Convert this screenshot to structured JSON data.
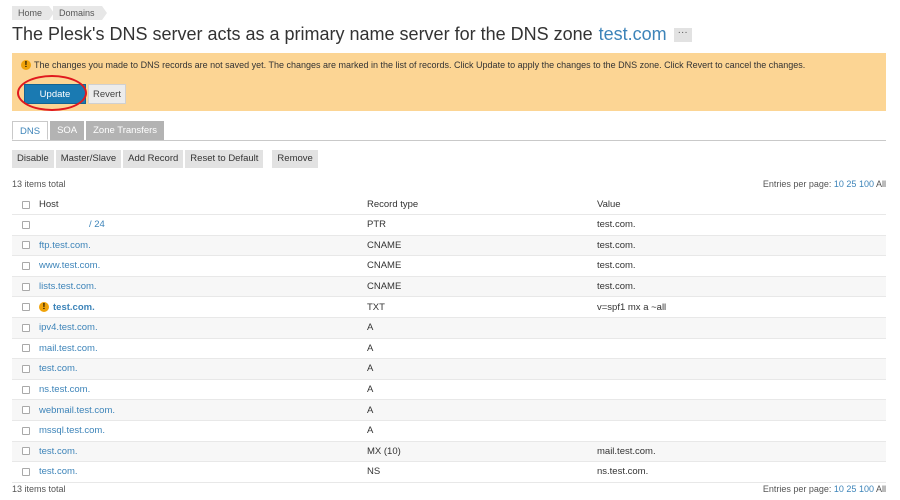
{
  "breadcrumbs": [
    "Home",
    "Domains"
  ],
  "title": {
    "prefix": "The Plesk's DNS server acts as a primary name server for the DNS zone",
    "zone": "test.com",
    "more": "···"
  },
  "warning": {
    "text": "The changes you made to DNS records are not saved yet. The changes are marked in the list of records. Click Update to apply the changes to the DNS zone. Click Revert to cancel the changes.",
    "update_label": "Update",
    "revert_label": "Revert"
  },
  "tabs": [
    "DNS",
    "SOA",
    "Zone Transfers"
  ],
  "toolbar": [
    "Disable",
    "Master/Slave",
    "Add Record",
    "Reset to Default",
    "Remove"
  ],
  "summary": {
    "total": "13 items total",
    "per_page_label": "Entries per page:",
    "per_page_options": [
      "10",
      "25",
      "100"
    ],
    "per_page_all": "All"
  },
  "columns": [
    "Host",
    "Record type",
    "Value"
  ],
  "records": [
    {
      "host": "/ 24",
      "type": "PTR",
      "value": "test.com."
    },
    {
      "host": "ftp.test.com.",
      "type": "CNAME",
      "value": "test.com."
    },
    {
      "host": "www.test.com.",
      "type": "CNAME",
      "value": "test.com."
    },
    {
      "host": "lists.test.com.",
      "type": "CNAME",
      "value": "test.com."
    },
    {
      "host": "test.com.",
      "type": "TXT",
      "value": "v=spf1 mx a ~all"
    },
    {
      "host": "ipv4.test.com.",
      "type": "A",
      "value": ""
    },
    {
      "host": "mail.test.com.",
      "type": "A",
      "value": ""
    },
    {
      "host": "test.com.",
      "type": "A",
      "value": ""
    },
    {
      "host": "ns.test.com.",
      "type": "A",
      "value": ""
    },
    {
      "host": "webmail.test.com.",
      "type": "A",
      "value": ""
    },
    {
      "host": "mssql.test.com.",
      "type": "A",
      "value": ""
    },
    {
      "host": "test.com.",
      "type": "MX (10)",
      "value": "mail.test.com."
    },
    {
      "host": "test.com.",
      "type": "NS",
      "value": "ns.test.com."
    }
  ],
  "icons": {
    "warning": "!"
  },
  "colors": {
    "accent": "#3d84b9",
    "warning_bg": "#fcd594",
    "update_btn": "#1a7ab2",
    "highlight": "#e0191e"
  }
}
